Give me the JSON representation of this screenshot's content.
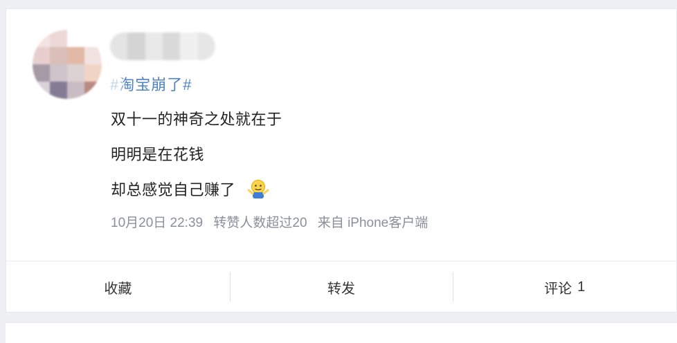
{
  "post": {
    "topic": "#淘宝崩了#",
    "lines": [
      "双十一的神奇之处就在于",
      "明明是在花钱",
      "却总感觉自己赚了"
    ],
    "emoji": "shrug-emoji",
    "meta": {
      "datetime": "10月20日 22:39",
      "reposts_note": "转赞人数超过20",
      "source": "来自 iPhone客户端"
    }
  },
  "actions": {
    "favorite_label": "收藏",
    "repost_label": "转发",
    "comment_label": "评论",
    "comment_count": "1"
  },
  "colors": {
    "topic": "#4d82c6",
    "text": "#222222",
    "meta": "#8a8f99",
    "page_bg": "#eef0f3"
  }
}
